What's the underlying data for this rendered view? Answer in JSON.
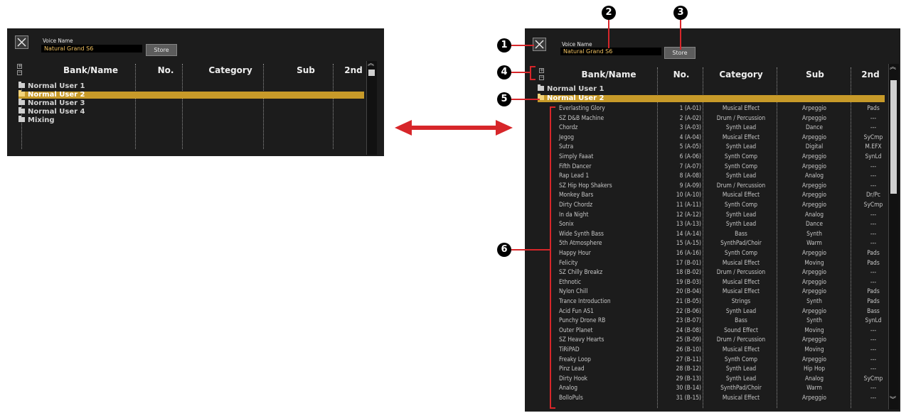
{
  "voice_name": {
    "label": "Voice Name",
    "value": "Natural Grand S6"
  },
  "store_label": "Store",
  "headers": {
    "bank_name": "Bank/Name",
    "no": "No.",
    "category": "Category",
    "sub": "Sub",
    "second": "2nd"
  },
  "expand_icons": {
    "expand": "+",
    "collapse": "−"
  },
  "banks_small": [
    "Normal User 1",
    "Normal User 2",
    "Normal User 3",
    "Normal User 4",
    "Mixing"
  ],
  "banks_large": [
    "Normal User 1",
    "Normal User 2"
  ],
  "selected_bank": "Normal User 2",
  "rows": [
    {
      "name": "Everlasting Glory",
      "no": "1 (A-01)",
      "category": "Musical Effect",
      "sub": "Arpeggio",
      "second": "Pads"
    },
    {
      "name": "SZ D&B Machine",
      "no": "2 (A-02)",
      "category": "Drum / Percussion",
      "sub": "Arpeggio",
      "second": "---"
    },
    {
      "name": "Chordz",
      "no": "3 (A-03)",
      "category": "Synth Lead",
      "sub": "Dance",
      "second": "---"
    },
    {
      "name": "Jegog",
      "no": "4 (A-04)",
      "category": "Musical Effect",
      "sub": "Arpeggio",
      "second": "SyCmp"
    },
    {
      "name": "Sutra",
      "no": "5 (A-05)",
      "category": "Synth Lead",
      "sub": "Digital",
      "second": "M.EFX"
    },
    {
      "name": "Simply Faaat",
      "no": "6 (A-06)",
      "category": "Synth Comp",
      "sub": "Arpeggio",
      "second": "SynLd"
    },
    {
      "name": "Fifth Dancer",
      "no": "7 (A-07)",
      "category": "Synth Comp",
      "sub": "Arpeggio",
      "second": "---"
    },
    {
      "name": "Rap Lead 1",
      "no": "8 (A-08)",
      "category": "Synth Lead",
      "sub": "Analog",
      "second": "---"
    },
    {
      "name": "SZ Hip Hop Shakers",
      "no": "9 (A-09)",
      "category": "Drum / Percussion",
      "sub": "Arpeggio",
      "second": "---"
    },
    {
      "name": "Monkey Bars",
      "no": "10 (A-10)",
      "category": "Musical Effect",
      "sub": "Arpeggio",
      "second": "Dr/Pc"
    },
    {
      "name": "Dirty Chordz",
      "no": "11 (A-11)",
      "category": "Synth Comp",
      "sub": "Arpeggio",
      "second": "SyCmp"
    },
    {
      "name": "In da Night",
      "no": "12 (A-12)",
      "category": "Synth Lead",
      "sub": "Analog",
      "second": "---"
    },
    {
      "name": "Sonix",
      "no": "13 (A-13)",
      "category": "Synth Lead",
      "sub": "Dance",
      "second": "---"
    },
    {
      "name": "Wide Synth Bass",
      "no": "14 (A-14)",
      "category": "Bass",
      "sub": "Synth",
      "second": "---"
    },
    {
      "name": "5th Atmosphere",
      "no": "15 (A-15)",
      "category": "SynthPad/Choir",
      "sub": "Warm",
      "second": "---"
    },
    {
      "name": "Happy Hour",
      "no": "16 (A-16)",
      "category": "Synth Comp",
      "sub": "Arpeggio",
      "second": "Pads"
    },
    {
      "name": "Felicity",
      "no": "17 (B-01)",
      "category": "Musical Effect",
      "sub": "Moving",
      "second": "Pads"
    },
    {
      "name": "SZ Chilly Breakz",
      "no": "18 (B-02)",
      "category": "Drum / Percussion",
      "sub": "Arpeggio",
      "second": "---"
    },
    {
      "name": "Ethnotic",
      "no": "19 (B-03)",
      "category": "Musical Effect",
      "sub": "Arpeggio",
      "second": "---"
    },
    {
      "name": "Nylon Chill",
      "no": "20 (B-04)",
      "category": "Musical Effect",
      "sub": "Arpeggio",
      "second": "Pads"
    },
    {
      "name": "Trance Introduction",
      "no": "21 (B-05)",
      "category": "Strings",
      "sub": "Synth",
      "second": "Pads"
    },
    {
      "name": "Acid Fun AS1",
      "no": "22 (B-06)",
      "category": "Synth Lead",
      "sub": "Arpeggio",
      "second": "Bass"
    },
    {
      "name": "Punchy Drone RB",
      "no": "23 (B-07)",
      "category": "Bass",
      "sub": "Synth",
      "second": "SynLd"
    },
    {
      "name": "Outer Planet",
      "no": "24 (B-08)",
      "category": "Sound Effect",
      "sub": "Moving",
      "second": "---"
    },
    {
      "name": "SZ Heavy Hearts",
      "no": "25 (B-09)",
      "category": "Drum / Percussion",
      "sub": "Arpeggio",
      "second": "---"
    },
    {
      "name": "TiRiPAD",
      "no": "26 (B-10)",
      "category": "Musical Effect",
      "sub": "Moving",
      "second": "---"
    },
    {
      "name": "Freaky Loop",
      "no": "27 (B-11)",
      "category": "Synth Comp",
      "sub": "Arpeggio",
      "second": "---"
    },
    {
      "name": "Pinz Lead",
      "no": "28 (B-12)",
      "category": "Synth Lead",
      "sub": "Hip Hop",
      "second": "---"
    },
    {
      "name": "Dirty Hook",
      "no": "29 (B-13)",
      "category": "Synth Lead",
      "sub": "Analog",
      "second": "SyCmp"
    },
    {
      "name": "Analog",
      "no": "30 (B-14)",
      "category": "SynthPad/Choir",
      "sub": "Warm",
      "second": "---"
    },
    {
      "name": "BolloPuls",
      "no": "31 (B-15)",
      "category": "Musical Effect",
      "sub": "Arpeggio",
      "second": "---"
    }
  ],
  "callouts": [
    "1",
    "2",
    "3",
    "4",
    "5",
    "6"
  ],
  "colors": {
    "panel_bg": "#1c1c1c",
    "selected_row": "#c79a29",
    "voice_name_text": "#f2c260",
    "callout_lines": "#d7262a"
  },
  "icons": {
    "close": "close-icon",
    "folder": "folder-icon",
    "open_folder": "open-folder-icon",
    "scroll_up": "double-chevron-up-icon",
    "scroll_down": "double-chevron-down-icon",
    "arrow": "double-headed-arrow-icon"
  }
}
